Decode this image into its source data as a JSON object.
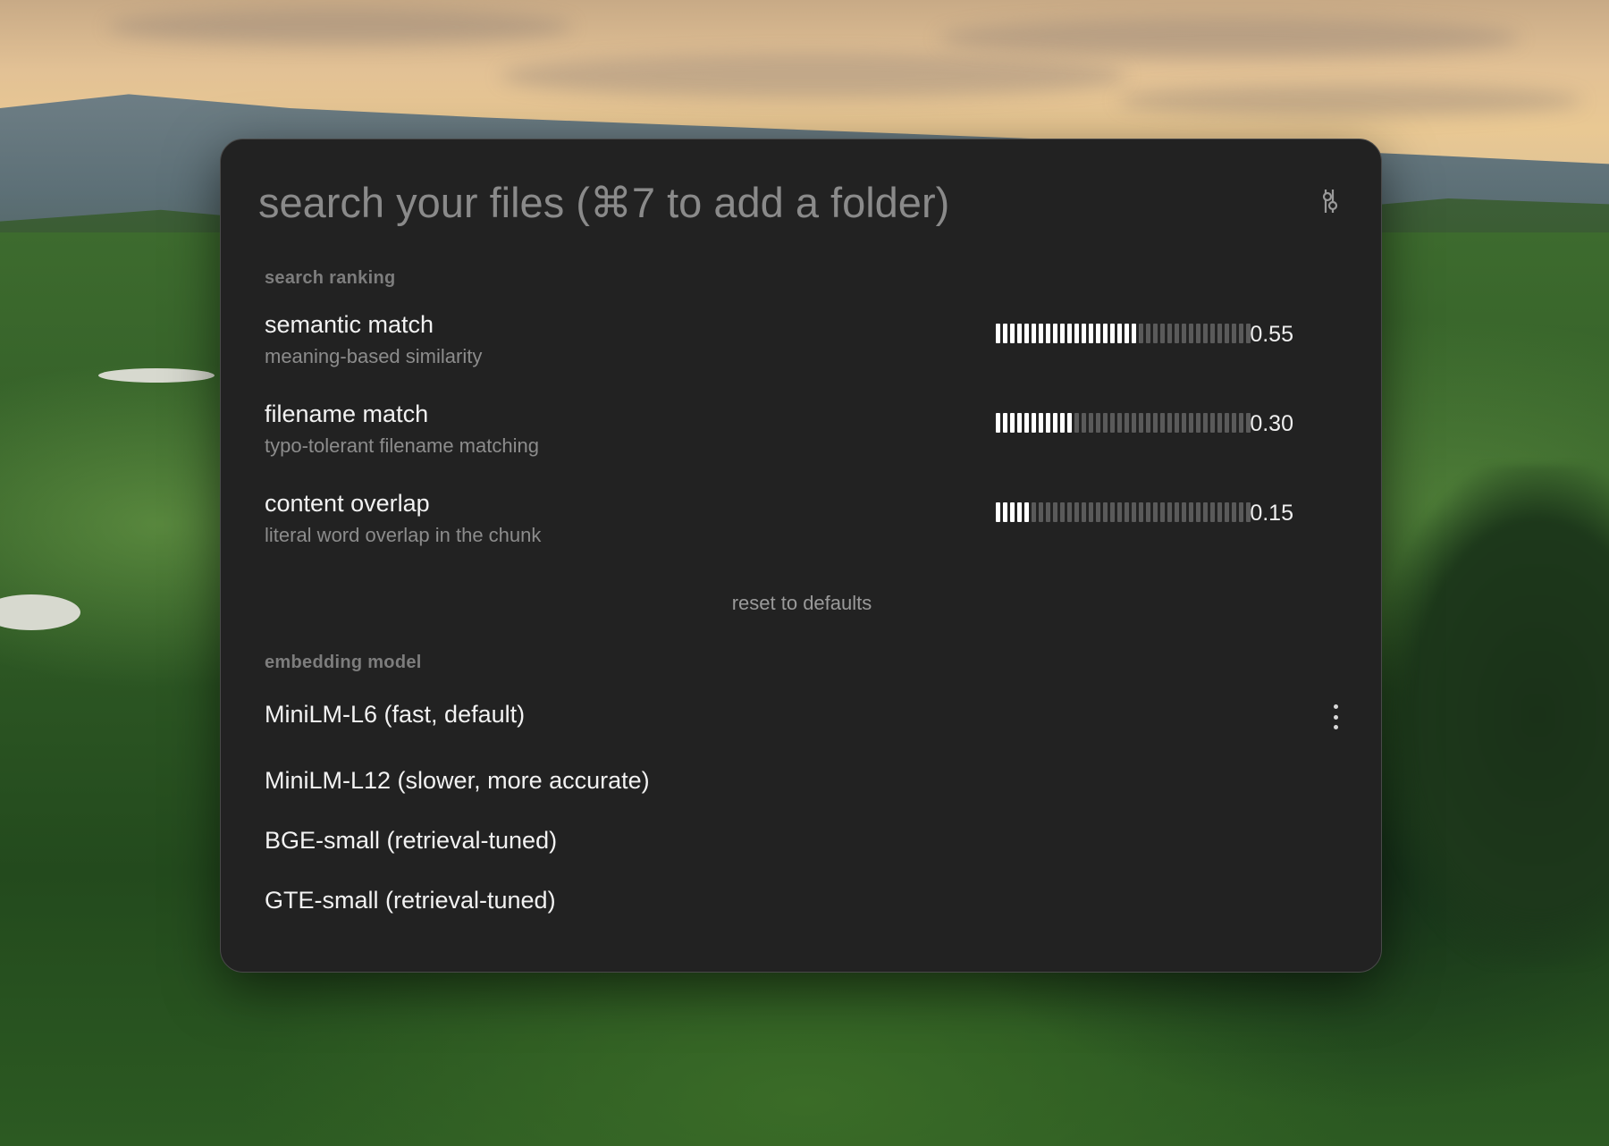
{
  "search": {
    "placeholder": "search your files (⌘7 to add a folder)",
    "value": "",
    "tools_icon": "toggle-settings-icon"
  },
  "ranking": {
    "section_label": "search ranking",
    "weights": [
      {
        "name": "semantic match",
        "description": "meaning-based similarity",
        "value": 0.55,
        "value_text": "0.55"
      },
      {
        "name": "filename match",
        "description": "typo-tolerant filename matching",
        "value": 0.3,
        "value_text": "0.30"
      },
      {
        "name": "content overlap",
        "description": "literal word overlap in the chunk",
        "value": 0.15,
        "value_text": "0.15"
      }
    ],
    "reset_label": "reset to defaults"
  },
  "embedding": {
    "section_label": "embedding model",
    "models": [
      {
        "label": "MiniLM-L6 (fast, default)",
        "selected": true
      },
      {
        "label": "MiniLM-L12 (slower, more accurate)",
        "selected": false
      },
      {
        "label": "BGE-small (retrieval-tuned)",
        "selected": false
      },
      {
        "label": "GTE-small (retrieval-tuned)",
        "selected": false
      }
    ],
    "menu_icon": "more-vertical-icon"
  },
  "colors": {
    "panel_bg": "#222222",
    "tick_on": "#ffffff",
    "tick_off": "#5a5a5a",
    "muted_text": "#8c8c8c"
  }
}
